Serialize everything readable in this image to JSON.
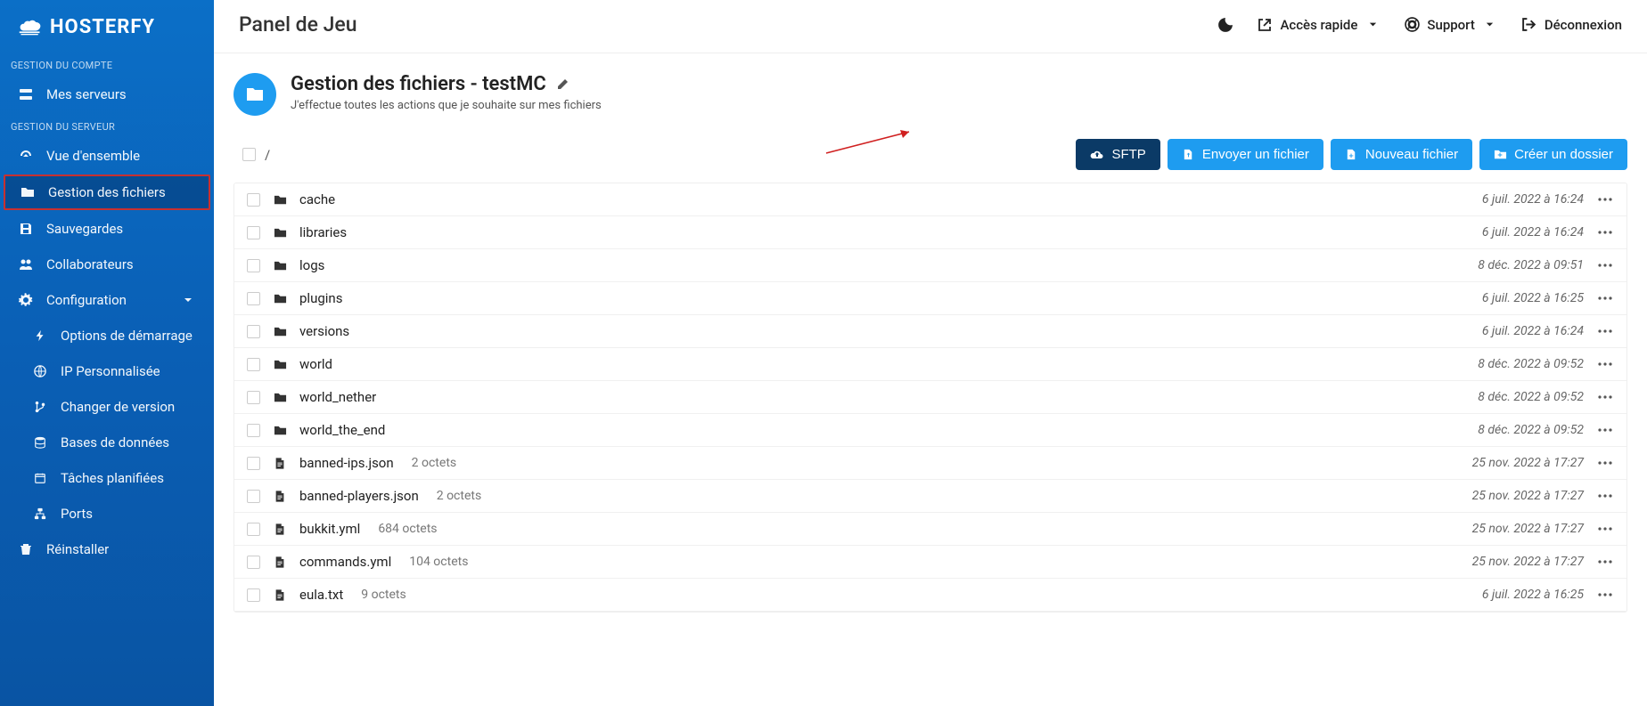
{
  "brand": "HOSTERFY",
  "sidebar": {
    "section_account": "GESTION DU COMPTE",
    "section_server": "GESTION DU SERVEUR",
    "items": {
      "servers": "Mes serveurs",
      "overview": "Vue d'ensemble",
      "files": "Gestion des fichiers",
      "backups": "Sauvegardes",
      "collab": "Collaborateurs",
      "config": "Configuration",
      "startup": "Options de démarrage",
      "ip": "IP Personnalisée",
      "version": "Changer de version",
      "db": "Bases de données",
      "tasks": "Tâches planifiées",
      "ports": "Ports",
      "reinstall": "Réinstaller"
    }
  },
  "topbar": {
    "title": "Panel de Jeu",
    "quick": "Accès rapide",
    "support": "Support",
    "logout": "Déconnexion"
  },
  "header": {
    "title": "Gestion des fichiers - testMC",
    "subtitle": "J'effectue toutes les actions que je souhaite sur mes fichiers"
  },
  "breadcrumb": "/",
  "buttons": {
    "sftp": "SFTP",
    "upload": "Envoyer un fichier",
    "newfile": "Nouveau fichier",
    "newfolder": "Créer un dossier"
  },
  "files": [
    {
      "type": "folder",
      "name": "cache",
      "size": "",
      "date": "6 juil. 2022 à 16:24"
    },
    {
      "type": "folder",
      "name": "libraries",
      "size": "",
      "date": "6 juil. 2022 à 16:24"
    },
    {
      "type": "folder",
      "name": "logs",
      "size": "",
      "date": "8 déc. 2022 à 09:51"
    },
    {
      "type": "folder",
      "name": "plugins",
      "size": "",
      "date": "6 juil. 2022 à 16:25"
    },
    {
      "type": "folder",
      "name": "versions",
      "size": "",
      "date": "6 juil. 2022 à 16:24"
    },
    {
      "type": "folder",
      "name": "world",
      "size": "",
      "date": "8 déc. 2022 à 09:52"
    },
    {
      "type": "folder",
      "name": "world_nether",
      "size": "",
      "date": "8 déc. 2022 à 09:52"
    },
    {
      "type": "folder",
      "name": "world_the_end",
      "size": "",
      "date": "8 déc. 2022 à 09:52"
    },
    {
      "type": "file",
      "name": "banned-ips.json",
      "size": "2 octets",
      "date": "25 nov. 2022 à 17:27"
    },
    {
      "type": "file",
      "name": "banned-players.json",
      "size": "2 octets",
      "date": "25 nov. 2022 à 17:27"
    },
    {
      "type": "file",
      "name": "bukkit.yml",
      "size": "684 octets",
      "date": "25 nov. 2022 à 17:27"
    },
    {
      "type": "file",
      "name": "commands.yml",
      "size": "104 octets",
      "date": "25 nov. 2022 à 17:27"
    },
    {
      "type": "file",
      "name": "eula.txt",
      "size": "9 octets",
      "date": "6 juil. 2022 à 16:25"
    }
  ],
  "colors": {
    "accent": "#1e9cf0",
    "dark": "#0b3a66",
    "highlight_border": "#c83030"
  }
}
